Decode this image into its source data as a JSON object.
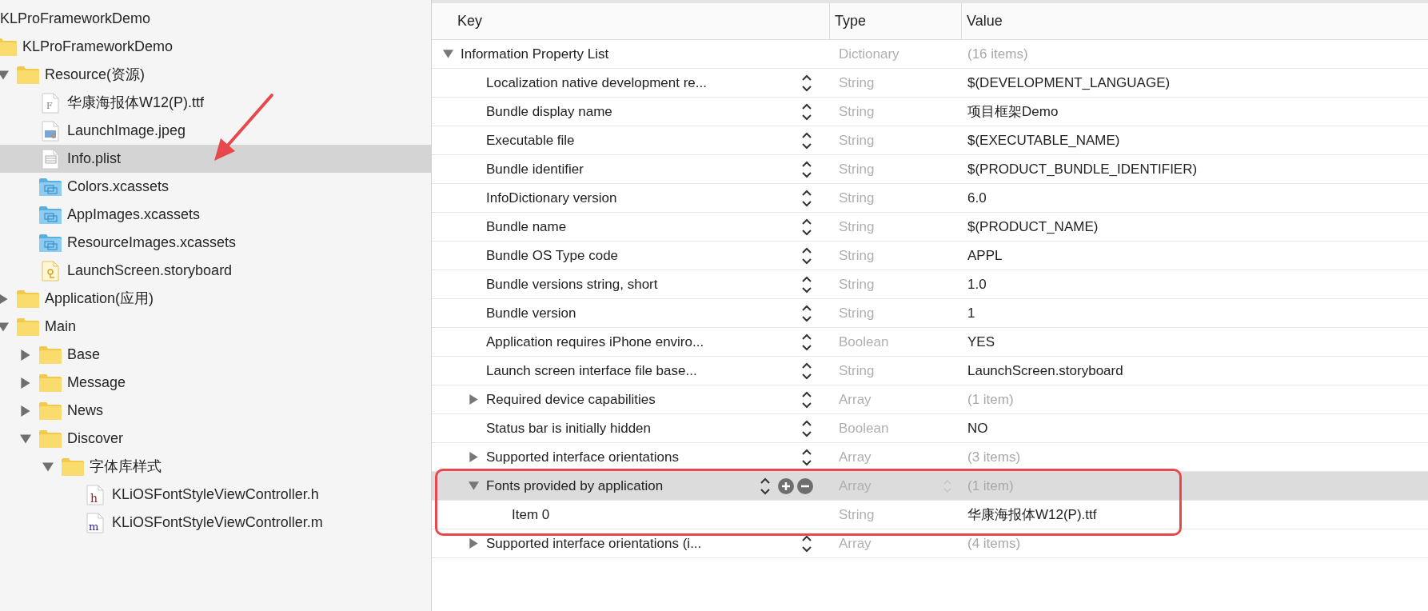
{
  "navigator": {
    "items": [
      {
        "label": "KLProFrameworkDemo",
        "selected": false,
        "children": [
          {
            "label": "KLProFrameworkDemo",
            "kind": "folder",
            "selected": false,
            "children": [
              {
                "label": "Resource(资源)",
                "kind": "folder",
                "expanded": true,
                "selected": false,
                "children": [
                  {
                    "label": "华康海报体W12(P).ttf",
                    "kind": "font-file",
                    "glyph": "F",
                    "selected": false
                  },
                  {
                    "label": "LaunchImage.jpeg",
                    "kind": "image-file",
                    "selected": false
                  },
                  {
                    "label": "Info.plist",
                    "kind": "plist-file",
                    "selected": true,
                    "pointed_at": true
                  },
                  {
                    "label": "Colors.xcassets",
                    "kind": "asset-catalog",
                    "selected": false
                  },
                  {
                    "label": "AppImages.xcassets",
                    "kind": "asset-catalog",
                    "selected": false
                  },
                  {
                    "label": "ResourceImages.xcassets",
                    "kind": "asset-catalog",
                    "selected": false
                  },
                  {
                    "label": "LaunchScreen.storyboard",
                    "kind": "storyboard-file",
                    "selected": false
                  }
                ]
              },
              {
                "label": "Application(应用)",
                "kind": "folder",
                "expanded": false,
                "selected": false
              },
              {
                "label": "Main",
                "kind": "folder",
                "expanded": true,
                "selected": false,
                "children": [
                  {
                    "label": "Base",
                    "kind": "folder",
                    "expanded": false,
                    "selected": false
                  },
                  {
                    "label": "Message",
                    "kind": "folder",
                    "expanded": false,
                    "selected": false
                  },
                  {
                    "label": "News",
                    "kind": "folder",
                    "expanded": false,
                    "selected": false
                  },
                  {
                    "label": "Discover",
                    "kind": "folder",
                    "expanded": true,
                    "selected": false,
                    "children": [
                      {
                        "label": "字体库样式",
                        "kind": "folder",
                        "expanded": true,
                        "selected": false,
                        "children": [
                          {
                            "label": "KLiOSFontStyleViewController.h",
                            "kind": "header-file",
                            "glyph": "h",
                            "selected": false
                          },
                          {
                            "label": "KLiOSFontStyleViewController.m",
                            "kind": "source-file",
                            "glyph": "m",
                            "selected": false
                          }
                        ]
                      }
                    ]
                  }
                ]
              }
            ]
          }
        ]
      }
    ]
  },
  "plist": {
    "columns": [
      "Key",
      "Type",
      "Value"
    ],
    "rows": [
      {
        "key": "Information Property List",
        "type": "Dictionary",
        "value": "(16 items)",
        "kind": "dictionary",
        "expanded": true,
        "selected": false,
        "children": [
          {
            "key": "Localization native development re...",
            "type": "String",
            "value": "$(DEVELOPMENT_LANGUAGE)",
            "selected": false
          },
          {
            "key": "Bundle display name",
            "type": "String",
            "value": "项目框架Demo",
            "selected": false
          },
          {
            "key": "Executable file",
            "type": "String",
            "value": "$(EXECUTABLE_NAME)",
            "selected": false
          },
          {
            "key": "Bundle identifier",
            "type": "String",
            "value": "$(PRODUCT_BUNDLE_IDENTIFIER)",
            "selected": false
          },
          {
            "key": "InfoDictionary version",
            "type": "String",
            "value": "6.0",
            "selected": false
          },
          {
            "key": "Bundle name",
            "type": "String",
            "value": "$(PRODUCT_NAME)",
            "selected": false
          },
          {
            "key": "Bundle OS Type code",
            "type": "String",
            "value": "APPL",
            "selected": false
          },
          {
            "key": "Bundle versions string, short",
            "type": "String",
            "value": "1.0",
            "selected": false
          },
          {
            "key": "Bundle version",
            "type": "String",
            "value": "1",
            "selected": false
          },
          {
            "key": "Application requires iPhone enviro...",
            "type": "Boolean",
            "value": "YES",
            "selected": false
          },
          {
            "key": "Launch screen interface file base...",
            "type": "String",
            "value": "LaunchScreen.storyboard",
            "selected": false
          },
          {
            "key": "Required device capabilities",
            "type": "Array",
            "value": "(1 item)",
            "kind": "array",
            "expanded": false,
            "selected": false
          },
          {
            "key": "Status bar is initially hidden",
            "type": "Boolean",
            "value": "NO",
            "selected": false
          },
          {
            "key": "Supported interface orientations",
            "type": "Array",
            "value": "(3 items)",
            "kind": "array",
            "expanded": false,
            "selected": false
          },
          {
            "key": "Fonts provided by application",
            "type": "Array",
            "value": "(1 item)",
            "kind": "array",
            "expanded": true,
            "selected": true,
            "highlighted": true,
            "children": [
              {
                "key": "Item 0",
                "type": "String",
                "value": "华康海报体W12(P).ttf",
                "selected": false
              }
            ]
          },
          {
            "key": "Supported interface orientations (i...",
            "type": "Array",
            "value": "(4 items)",
            "kind": "array",
            "expanded": false,
            "selected": false
          }
        ]
      }
    ]
  }
}
